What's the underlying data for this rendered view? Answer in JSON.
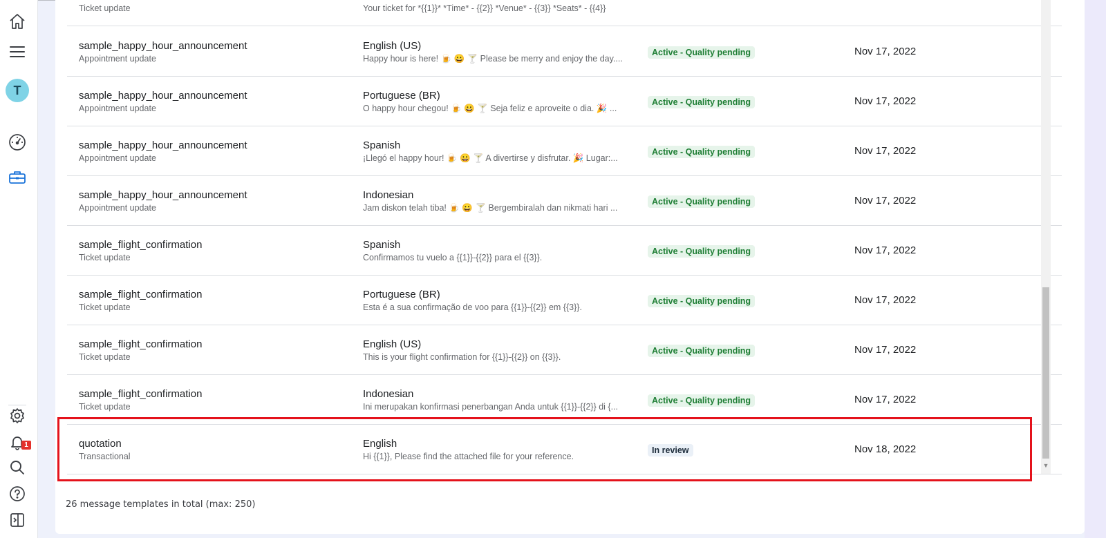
{
  "nav": {
    "avatar_letter": "T",
    "notification_count": "1",
    "icons": [
      "home-icon",
      "menu-icon",
      "avatar",
      "dashboard-gauge-icon",
      "briefcase-icon",
      "gear-icon",
      "bell-icon",
      "search-icon",
      "help-icon",
      "collapse-sidebar-icon"
    ]
  },
  "partial_row": {
    "category": "Ticket update",
    "body": "Your ticket for *{{1}}* *Time* - {{2}} *Venue* - {{3}} *Seats* - {{4}}"
  },
  "rows": [
    {
      "name": "sample_happy_hour_announcement",
      "category": "Appointment update",
      "language": "English (US)",
      "body": "Happy hour is here! 🍺 😀 🍸  Please be merry and enjoy the day....",
      "status": "Active - Quality pending",
      "date": "Nov 17, 2022"
    },
    {
      "name": "sample_happy_hour_announcement",
      "category": "Appointment update",
      "language": "Portuguese (BR)",
      "body": "O happy hour chegou! 🍺 😀 🍸  Seja feliz e aproveite o dia. 🎉  ...",
      "status": "Active - Quality pending",
      "date": "Nov 17, 2022"
    },
    {
      "name": "sample_happy_hour_announcement",
      "category": "Appointment update",
      "language": "Spanish",
      "body": "¡Llegó el happy hour! 🍺 😀 🍸  A divertirse y disfrutar. 🎉  Lugar:...",
      "status": "Active - Quality pending",
      "date": "Nov 17, 2022"
    },
    {
      "name": "sample_happy_hour_announcement",
      "category": "Appointment update",
      "language": "Indonesian",
      "body": "Jam diskon telah tiba! 🍺 😀 🍸  Bergembiralah dan nikmati hari ...",
      "status": "Active - Quality pending",
      "date": "Nov 17, 2022"
    },
    {
      "name": "sample_flight_confirmation",
      "category": "Ticket update",
      "language": "Spanish",
      "body": "Confirmamos tu vuelo a {{1}}-{{2}} para el {{3}}.",
      "status": "Active - Quality pending",
      "date": "Nov 17, 2022"
    },
    {
      "name": "sample_flight_confirmation",
      "category": "Ticket update",
      "language": "Portuguese (BR)",
      "body": "Esta é a sua confirmação de voo para {{1}}-{{2}} em {{3}}.",
      "status": "Active - Quality pending",
      "date": "Nov 17, 2022"
    },
    {
      "name": "sample_flight_confirmation",
      "category": "Ticket update",
      "language": "English (US)",
      "body": "This is your flight confirmation for {{1}}-{{2}} on {{3}}.",
      "status": "Active - Quality pending",
      "date": "Nov 17, 2022"
    },
    {
      "name": "sample_flight_confirmation",
      "category": "Ticket update",
      "language": "Indonesian",
      "body": "Ini merupakan konfirmasi penerbangan Anda untuk {{1}}-{{2}} di {...",
      "status": "Active - Quality pending",
      "date": "Nov 17, 2022"
    },
    {
      "name": "quotation",
      "category": "Transactional",
      "language": "English",
      "body": "Hi {{1}}, Please find the attached file for your reference.",
      "status": "In review",
      "date": "Nov 18, 2022"
    }
  ],
  "footer": {
    "summary": "26 message templates in total (max: 250)"
  },
  "colors": {
    "highlight": "#e4121b",
    "active_status": "#1e7e34",
    "active_status_bg": "#e6f4ea",
    "review_status_bg": "#eaf0f7",
    "notification": "#e4312b",
    "avatar": "#7fd3e6"
  }
}
